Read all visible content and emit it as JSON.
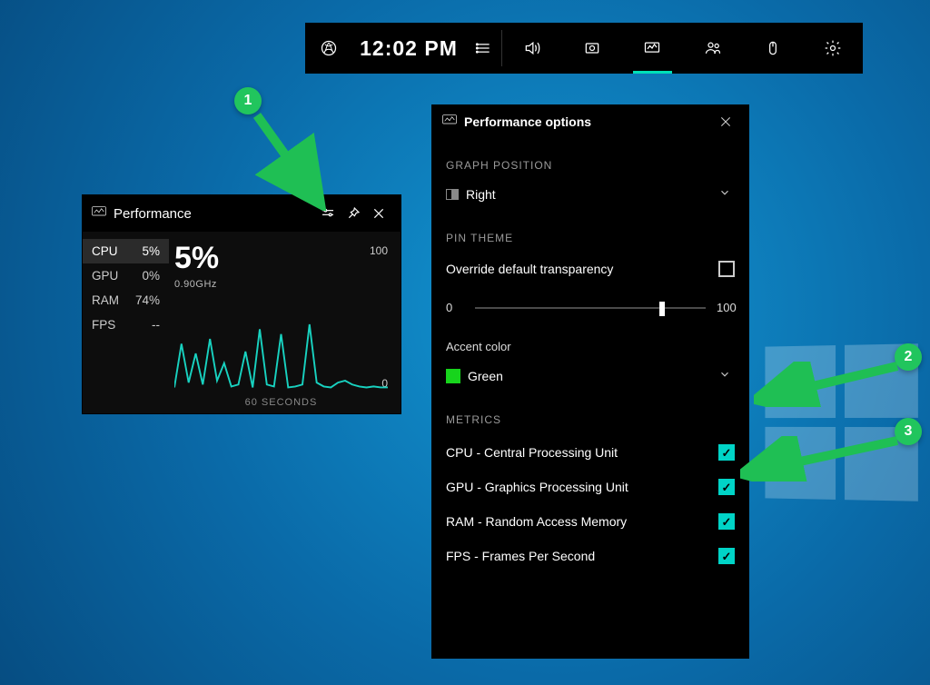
{
  "gamebar": {
    "time": "12:02 PM"
  },
  "perf_widget": {
    "title": "Performance",
    "metrics": [
      {
        "label": "CPU",
        "value": "5%"
      },
      {
        "label": "GPU",
        "value": "0%"
      },
      {
        "label": "RAM",
        "value": "74%"
      },
      {
        "label": "FPS",
        "value": "--"
      }
    ],
    "big_value": "5%",
    "freq": "0.90GHz",
    "y_max": "100",
    "y_min": "0",
    "x_label": "60 SECONDS"
  },
  "options": {
    "title": "Performance options",
    "graph_position_label": "GRAPH POSITION",
    "graph_position_value": "Right",
    "pin_theme_label": "PIN THEME",
    "override_label": "Override default transparency",
    "override_checked": false,
    "slider_min": "0",
    "slider_max": "100",
    "slider_value": 80,
    "accent_label": "Accent color",
    "accent_value": "Green",
    "metrics_label": "METRICS",
    "metrics": [
      {
        "label": "CPU - Central Processing Unit",
        "checked": true
      },
      {
        "label": "GPU - Graphics Processing Unit",
        "checked": true
      },
      {
        "label": "RAM - Random Access Memory",
        "checked": true
      },
      {
        "label": "FPS - Frames Per Second",
        "checked": true
      }
    ]
  },
  "annotations": {
    "b1": "1",
    "b2": "2",
    "b3": "3"
  },
  "chart_data": {
    "type": "line",
    "title": "CPU usage",
    "xlabel": "60 SECONDS",
    "ylabel": "",
    "ylim": [
      0,
      100
    ],
    "x": [
      0,
      2,
      4,
      6,
      8,
      10,
      12,
      14,
      16,
      18,
      20,
      22,
      24,
      26,
      28,
      30,
      32,
      34,
      36,
      38,
      40,
      42,
      44,
      46,
      48,
      50,
      52,
      54,
      56,
      58,
      60
    ],
    "values": [
      5,
      50,
      10,
      40,
      8,
      55,
      12,
      30,
      6,
      8,
      42,
      5,
      65,
      8,
      6,
      60,
      5,
      6,
      8,
      70,
      10,
      6,
      5,
      10,
      12,
      8,
      6,
      5,
      6,
      5,
      5
    ]
  }
}
